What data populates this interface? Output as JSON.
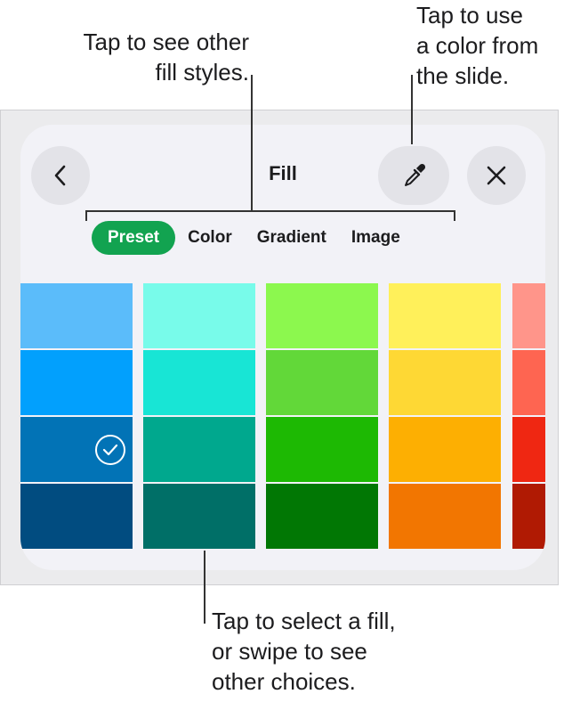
{
  "callouts": {
    "fill_styles": "Tap to see other\nfill styles.",
    "eyedropper": "Tap to use\na color from\nthe slide.",
    "swatches": "Tap to select a fill,\nor swipe to see\nother choices."
  },
  "panel": {
    "title": "Fill",
    "back_icon": "chevron-left-icon",
    "eyedropper_icon": "eyedropper-icon",
    "close_icon": "close-icon"
  },
  "tabs": [
    {
      "label": "Preset",
      "active": true
    },
    {
      "label": "Color",
      "active": false
    },
    {
      "label": "Gradient",
      "active": false
    },
    {
      "label": "Image",
      "active": false
    }
  ],
  "accent_color": "#12a350",
  "swatch_columns": [
    {
      "colors": [
        "#5bbcfa",
        "#02a0fd",
        "#0273b6",
        "#014c80"
      ]
    },
    {
      "colors": [
        "#78fbea",
        "#18e5d5",
        "#00a88e",
        "#006f67"
      ]
    },
    {
      "colors": [
        "#8cf84e",
        "#62d839",
        "#1db903",
        "#017704"
      ]
    },
    {
      "colors": [
        "#fff05a",
        "#fed834",
        "#fdaf02",
        "#f27601"
      ]
    },
    {
      "colors": [
        "#ff958a",
        "#fe6551",
        "#ef2712",
        "#b01a03"
      ]
    }
  ],
  "selected_swatch": {
    "column": 0,
    "row": 2
  }
}
